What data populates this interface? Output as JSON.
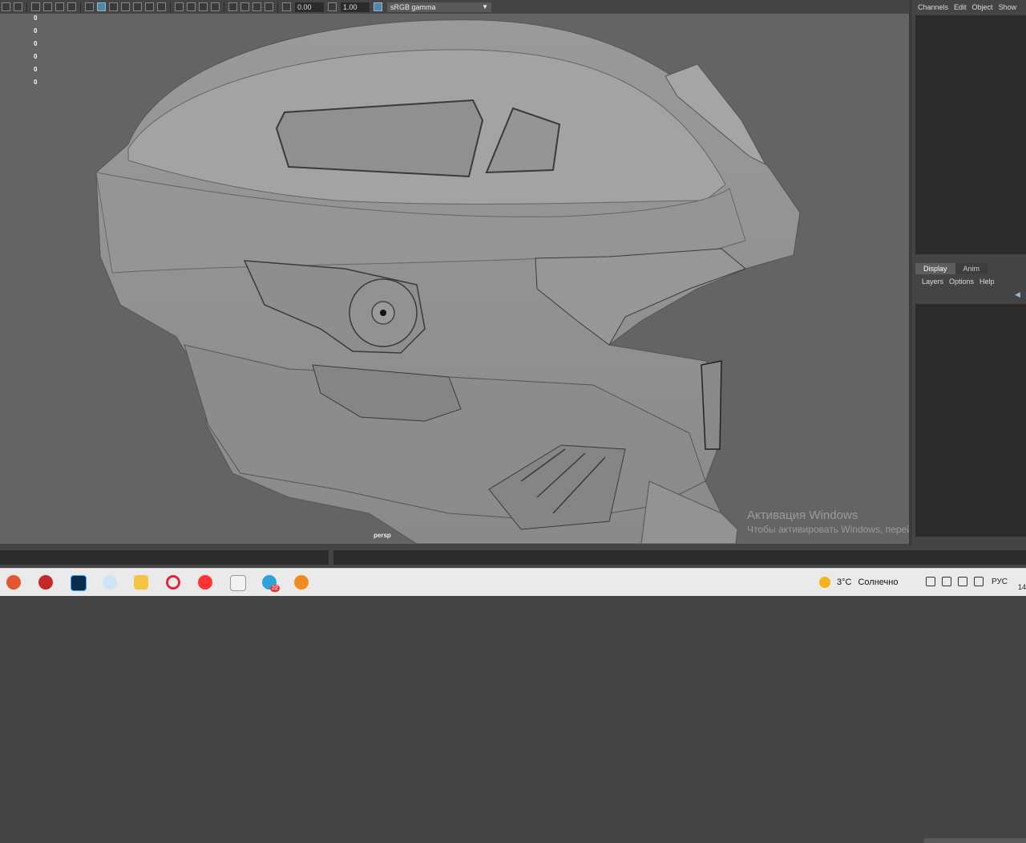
{
  "toolbar": {
    "exposure_value": "0.00",
    "gamma_value": "1.00",
    "color_space": "sRGB gamma"
  },
  "viewport": {
    "hud_values": [
      "0",
      "0",
      "0",
      "0",
      "0",
      "0"
    ],
    "camera_label": "persp"
  },
  "right_panel": {
    "channel_menu": [
      "Channels",
      "Edit",
      "Object",
      "Show"
    ],
    "layer_tabs": [
      "Display",
      "Anim"
    ],
    "layer_menu": [
      "Layers",
      "Options",
      "Help"
    ]
  },
  "watermark": {
    "title": "Активация Windows",
    "subtitle": "Чтобы активировать Windows, перейдите в раздел \"Параметры\""
  },
  "taskbar": {
    "telegram_badge": "22",
    "temperature": "3°C",
    "condition": "Солнечно",
    "language": "РУС",
    "clock": "14"
  }
}
